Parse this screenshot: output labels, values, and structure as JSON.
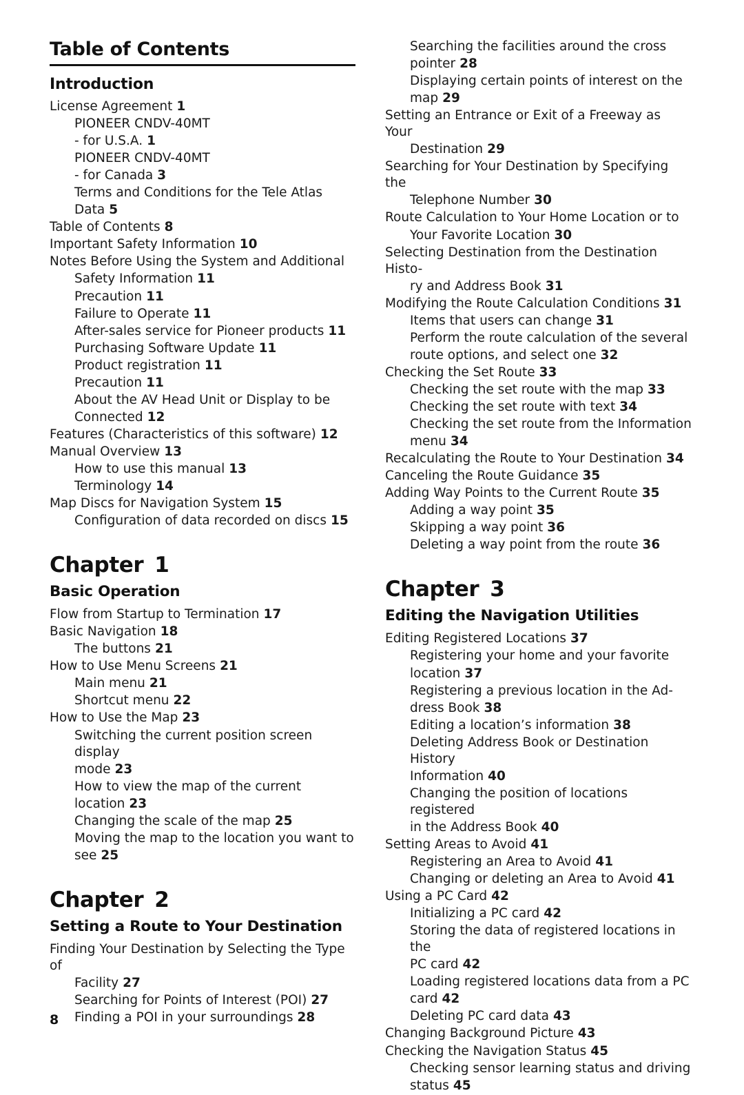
{
  "document": {
    "title": "Table of Contents",
    "page_number": "8"
  },
  "left_column": {
    "section_title": "Introduction",
    "entries": [
      {
        "text": "License Agreement",
        "page": "1",
        "level": 0
      },
      {
        "text": "PIONEER CNDV-40MT",
        "page": "",
        "level": 1
      },
      {
        "text": "- for U.S.A.",
        "page": "1",
        "level": 1
      },
      {
        "text": "PIONEER CNDV-40MT",
        "page": "",
        "level": 1
      },
      {
        "text": "- for Canada",
        "page": "3",
        "level": 1
      },
      {
        "text": "Terms and Conditions for the Tele Atlas",
        "page": "",
        "level": 1
      },
      {
        "text": "Data",
        "page": "5",
        "level": 1
      },
      {
        "text": "Table of Contents",
        "page": "8",
        "level": 0
      },
      {
        "text": "Important Safety Information",
        "page": "10",
        "level": 0
      },
      {
        "text": "Notes Before Using the System and Additional",
        "page": "",
        "level": 0
      },
      {
        "text": "Safety Information",
        "page": "11",
        "level": 1
      },
      {
        "text": "Precaution",
        "page": "11",
        "level": 1
      },
      {
        "text": "Failure to Operate",
        "page": "11",
        "level": 1
      },
      {
        "text": "After-sales service for Pioneer products",
        "page": "11",
        "level": 1
      },
      {
        "text": "Purchasing Software Update",
        "page": "11",
        "level": 1
      },
      {
        "text": "Product registration",
        "page": "11",
        "level": 1
      },
      {
        "text": "Precaution",
        "page": "11",
        "level": 1
      },
      {
        "text": "About the AV Head Unit or Display to be",
        "page": "",
        "level": 1
      },
      {
        "text": "Connected",
        "page": "12",
        "level": 1
      },
      {
        "text": "Features (Characteristics of this software)",
        "page": "12",
        "level": 0
      },
      {
        "text": "Manual Overview",
        "page": "13",
        "level": 0
      },
      {
        "text": "How to use this manual",
        "page": "13",
        "level": 1
      },
      {
        "text": "Terminology",
        "page": "14",
        "level": 1
      },
      {
        "text": "Map Discs for Navigation System",
        "page": "15",
        "level": 0
      },
      {
        "text": "Configuration of data recorded on discs",
        "page": "15",
        "level": 1
      }
    ],
    "chapter1": {
      "label": "Chapter",
      "number": "1",
      "subtitle": "Basic Operation",
      "entries": [
        {
          "text": "Flow from Startup to Termination",
          "page": "17",
          "level": 0
        },
        {
          "text": "Basic Navigation",
          "page": "18",
          "level": 0
        },
        {
          "text": "The buttons",
          "page": "21",
          "level": 1
        },
        {
          "text": "How to Use Menu Screens",
          "page": "21",
          "level": 0
        },
        {
          "text": "Main menu",
          "page": "21",
          "level": 1
        },
        {
          "text": "Shortcut menu",
          "page": "22",
          "level": 1
        },
        {
          "text": "How to Use the Map",
          "page": "23",
          "level": 0
        },
        {
          "text": "Switching the current position screen display",
          "page": "",
          "level": 1
        },
        {
          "text": "mode",
          "page": "23",
          "level": 1
        },
        {
          "text": "How to view the map of the current",
          "page": "",
          "level": 1
        },
        {
          "text": "location",
          "page": "23",
          "level": 1
        },
        {
          "text": "Changing the scale of the map",
          "page": "25",
          "level": 1
        },
        {
          "text": "Moving the map to the location you want to",
          "page": "",
          "level": 1
        },
        {
          "text": "see",
          "page": "25",
          "level": 1
        }
      ]
    },
    "chapter2": {
      "label": "Chapter",
      "number": "2",
      "subtitle": "Setting a Route to Your Destination",
      "entries": [
        {
          "text": "Finding Your Destination by Selecting the Type of",
          "page": "",
          "level": 0
        },
        {
          "text": "Facility",
          "page": "27",
          "level": 1
        },
        {
          "text": "Searching for Points of Interest (POI)",
          "page": "27",
          "level": 1
        },
        {
          "text": "Finding a POI in your surroundings",
          "page": "28",
          "level": 1
        }
      ]
    }
  },
  "right_column": {
    "continued_entries": [
      {
        "text": "Searching the facilities around the cross",
        "page": "",
        "level": 1
      },
      {
        "text": "pointer",
        "page": "28",
        "level": 1
      },
      {
        "text": "Displaying certain points of interest on the",
        "page": "",
        "level": 1
      },
      {
        "text": "map",
        "page": "29",
        "level": 1
      },
      {
        "text": "Setting an Entrance or Exit of a Freeway as Your",
        "page": "",
        "level": 0
      },
      {
        "text": "Destination",
        "page": "29",
        "level": 1
      },
      {
        "text": "Searching for Your Destination by Specifying the",
        "page": "",
        "level": 0
      },
      {
        "text": "Telephone Number",
        "page": "30",
        "level": 1
      },
      {
        "text": "Route Calculation to Your Home Location or to",
        "page": "",
        "level": 0
      },
      {
        "text": "Your Favorite Location",
        "page": "30",
        "level": 1
      },
      {
        "text": "Selecting Destination from the Destination Histo-",
        "page": "",
        "level": 0
      },
      {
        "text": "ry and Address Book",
        "page": "31",
        "level": 1
      },
      {
        "text": "Modifying the Route Calculation Conditions",
        "page": "31",
        "level": 0
      },
      {
        "text": "Items that users can change",
        "page": "31",
        "level": 1
      },
      {
        "text": "Perform the route calculation of the several",
        "page": "",
        "level": 1
      },
      {
        "text": "route options, and select one",
        "page": "32",
        "level": 1
      },
      {
        "text": "Checking the Set Route",
        "page": "33",
        "level": 0
      },
      {
        "text": "Checking the set route with the map",
        "page": "33",
        "level": 1
      },
      {
        "text": "Checking the set route with text",
        "page": "34",
        "level": 1
      },
      {
        "text": "Checking the set route from the Information",
        "page": "",
        "level": 1
      },
      {
        "text": "menu",
        "page": "34",
        "level": 1
      },
      {
        "text": "Recalculating the Route to Your Destination",
        "page": "34",
        "level": 0
      },
      {
        "text": "Canceling the Route Guidance",
        "page": "35",
        "level": 0
      },
      {
        "text": "Adding Way Points to the Current Route",
        "page": "35",
        "level": 0
      },
      {
        "text": "Adding a way point",
        "page": "35",
        "level": 1
      },
      {
        "text": "Skipping a way point",
        "page": "36",
        "level": 1
      },
      {
        "text": "Deleting a way point from the route",
        "page": "36",
        "level": 1
      }
    ],
    "chapter3": {
      "label": "Chapter",
      "number": "3",
      "subtitle": "Editing the Navigation Utilities",
      "entries": [
        {
          "text": "Editing Registered Locations",
          "page": "37",
          "level": 0
        },
        {
          "text": "Registering your home and your favorite",
          "page": "",
          "level": 1
        },
        {
          "text": "location",
          "page": "37",
          "level": 1
        },
        {
          "text": "Registering a previous location in the Ad-",
          "page": "",
          "level": 1
        },
        {
          "text": "dress Book",
          "page": "38",
          "level": 1
        },
        {
          "text": "Editing a location’s information",
          "page": "38",
          "level": 1
        },
        {
          "text": "Deleting Address Book or Destination History",
          "page": "",
          "level": 1
        },
        {
          "text": "Information",
          "page": "40",
          "level": 1
        },
        {
          "text": "Changing the position of locations registered",
          "page": "",
          "level": 1
        },
        {
          "text": "in the Address Book",
          "page": "40",
          "level": 1
        },
        {
          "text": "Setting Areas to Avoid",
          "page": "41",
          "level": 0
        },
        {
          "text": "Registering an Area to Avoid",
          "page": "41",
          "level": 1
        },
        {
          "text": "Changing or deleting an Area to Avoid",
          "page": "41",
          "level": 1
        },
        {
          "text": "Using a PC Card",
          "page": "42",
          "level": 0
        },
        {
          "text": "Initializing a PC card",
          "page": "42",
          "level": 1
        },
        {
          "text": "Storing the data of registered locations in the",
          "page": "",
          "level": 1
        },
        {
          "text": "PC card",
          "page": "42",
          "level": 1
        },
        {
          "text": "Loading registered locations data from a PC",
          "page": "",
          "level": 1
        },
        {
          "text": "card",
          "page": "42",
          "level": 1
        },
        {
          "text": "Deleting PC card data",
          "page": "43",
          "level": 1
        },
        {
          "text": "Changing Background Picture",
          "page": "43",
          "level": 0
        },
        {
          "text": "Checking the Navigation Status",
          "page": "45",
          "level": 0
        },
        {
          "text": "Checking sensor learning status and driving",
          "page": "",
          "level": 1
        },
        {
          "text": "status",
          "page": "45",
          "level": 1
        }
      ]
    }
  }
}
